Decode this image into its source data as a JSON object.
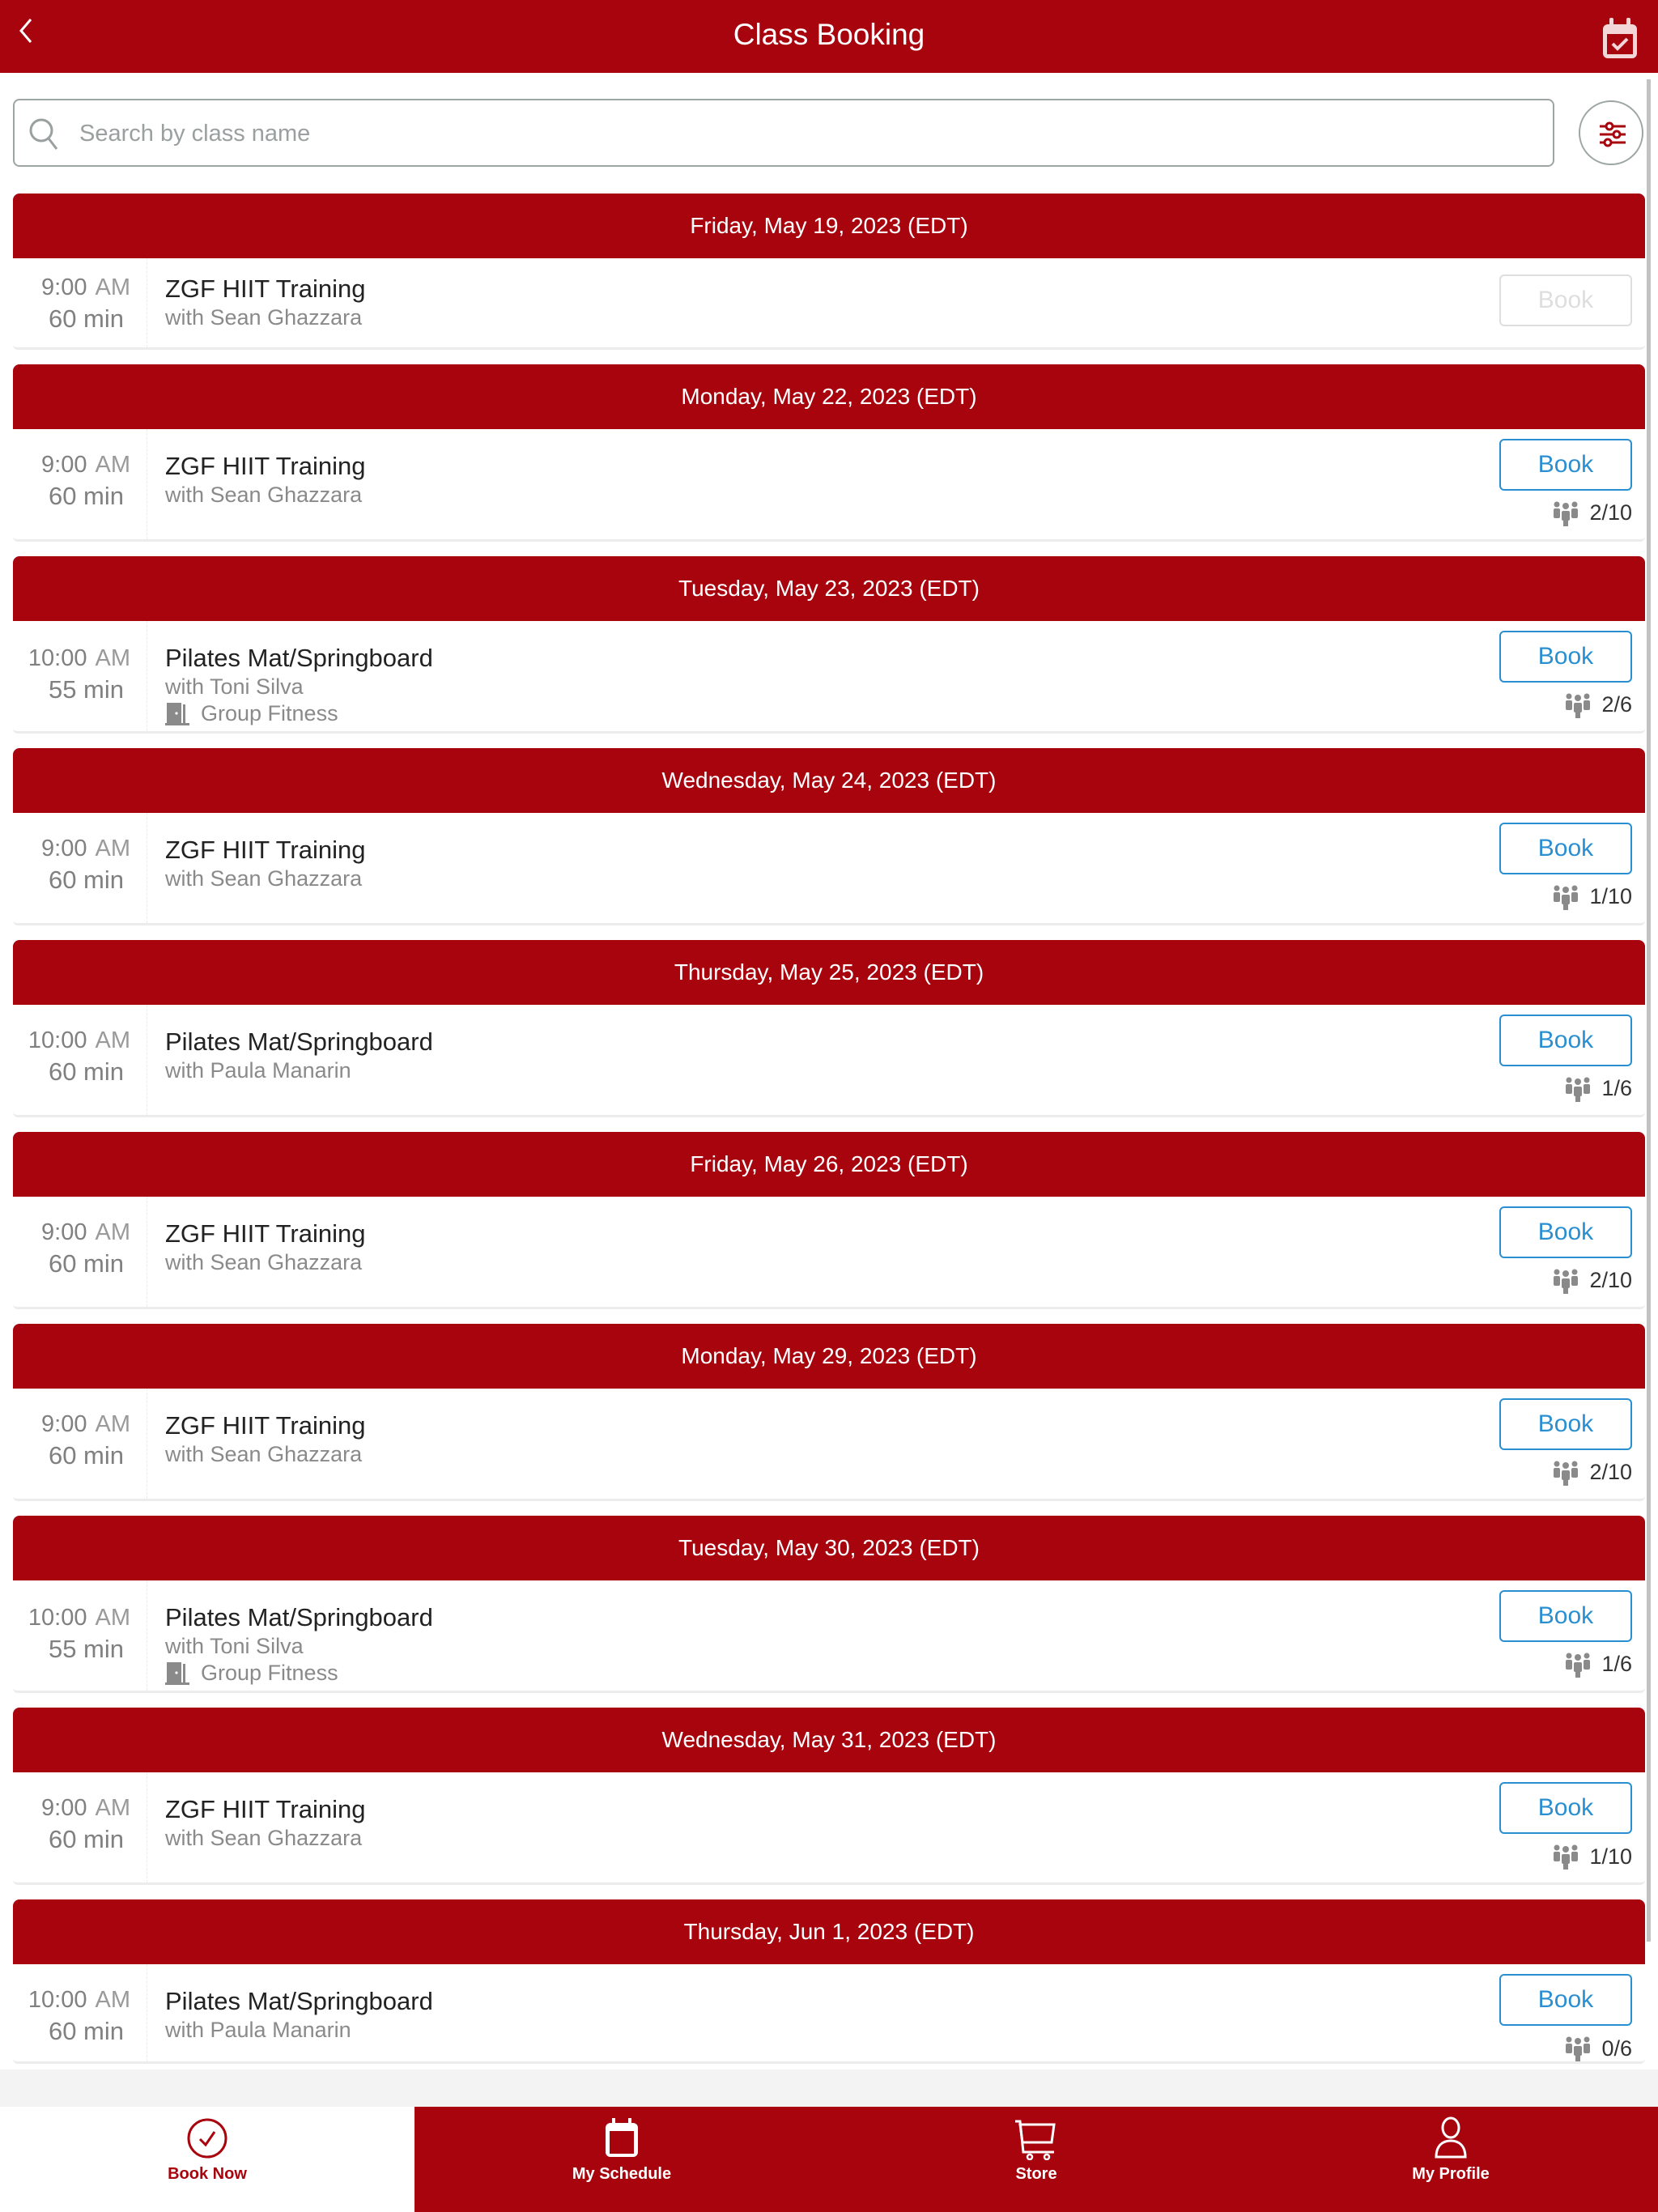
{
  "header": {
    "title": "Class Booking",
    "back_icon": "chevron-left-icon",
    "right_icon": "calendar-check-icon"
  },
  "search": {
    "placeholder": "Search by class name",
    "value": "",
    "icon": "search-icon",
    "filter_icon": "sliders-icon"
  },
  "colors": {
    "brand": "#a8040e",
    "book_button": "#2a8fd1",
    "disabled": "#dedede"
  },
  "days": [
    {
      "date": "Friday, May 19, 2023 (EDT)",
      "session": {
        "time": "9:00",
        "ampm": "AM",
        "duration": "60 min",
        "name": "ZGF HIIT Training",
        "instructor": "with Sean Ghazzara",
        "room": "",
        "book_label": "Book",
        "book_enabled": false,
        "spots": ""
      }
    },
    {
      "date": "Monday, May 22, 2023 (EDT)",
      "session": {
        "time": "9:00",
        "ampm": "AM",
        "duration": "60 min",
        "name": "ZGF HIIT Training",
        "instructor": "with Sean Ghazzara",
        "room": "",
        "book_label": "Book",
        "book_enabled": true,
        "spots": "2/10"
      }
    },
    {
      "date": "Tuesday, May 23, 2023 (EDT)",
      "session": {
        "time": "10:00",
        "ampm": "AM",
        "duration": "55 min",
        "name": "Pilates Mat/Springboard",
        "instructor": "with Toni Silva",
        "room": "Group Fitness",
        "book_label": "Book",
        "book_enabled": true,
        "spots": "2/6"
      }
    },
    {
      "date": "Wednesday, May 24, 2023 (EDT)",
      "session": {
        "time": "9:00",
        "ampm": "AM",
        "duration": "60 min",
        "name": "ZGF HIIT Training",
        "instructor": "with Sean Ghazzara",
        "room": "",
        "book_label": "Book",
        "book_enabled": true,
        "spots": "1/10"
      }
    },
    {
      "date": "Thursday, May 25, 2023 (EDT)",
      "session": {
        "time": "10:00",
        "ampm": "AM",
        "duration": "60 min",
        "name": "Pilates Mat/Springboard",
        "instructor": "with Paula Manarin",
        "room": "",
        "book_label": "Book",
        "book_enabled": true,
        "spots": "1/6"
      }
    },
    {
      "date": "Friday, May 26, 2023 (EDT)",
      "session": {
        "time": "9:00",
        "ampm": "AM",
        "duration": "60 min",
        "name": "ZGF HIIT Training",
        "instructor": "with Sean Ghazzara",
        "room": "",
        "book_label": "Book",
        "book_enabled": true,
        "spots": "2/10"
      }
    },
    {
      "date": "Monday, May 29, 2023 (EDT)",
      "session": {
        "time": "9:00",
        "ampm": "AM",
        "duration": "60 min",
        "name": "ZGF HIIT Training",
        "instructor": "with Sean Ghazzara",
        "room": "",
        "book_label": "Book",
        "book_enabled": true,
        "spots": "2/10"
      }
    },
    {
      "date": "Tuesday, May 30, 2023 (EDT)",
      "session": {
        "time": "10:00",
        "ampm": "AM",
        "duration": "55 min",
        "name": "Pilates Mat/Springboard",
        "instructor": "with Toni Silva",
        "room": "Group Fitness",
        "book_label": "Book",
        "book_enabled": true,
        "spots": "1/6"
      }
    },
    {
      "date": "Wednesday, May 31, 2023 (EDT)",
      "session": {
        "time": "9:00",
        "ampm": "AM",
        "duration": "60 min",
        "name": "ZGF HIIT Training",
        "instructor": "with Sean Ghazzara",
        "room": "",
        "book_label": "Book",
        "book_enabled": true,
        "spots": "1/10"
      }
    },
    {
      "date": "Thursday, Jun 1, 2023 (EDT)",
      "session": {
        "time": "10:00",
        "ampm": "AM",
        "duration": "60 min",
        "name": "Pilates Mat/Springboard",
        "instructor": "with Paula Manarin",
        "room": "",
        "book_label": "Book",
        "book_enabled": true,
        "spots": "0/6"
      }
    }
  ],
  "tabs": [
    {
      "label": "Book Now",
      "icon": "check-circle-icon",
      "active": true
    },
    {
      "label": "My Schedule",
      "icon": "calendar-icon",
      "active": false
    },
    {
      "label": "Store",
      "icon": "cart-icon",
      "active": false
    },
    {
      "label": "My Profile",
      "icon": "user-icon",
      "active": false
    }
  ]
}
